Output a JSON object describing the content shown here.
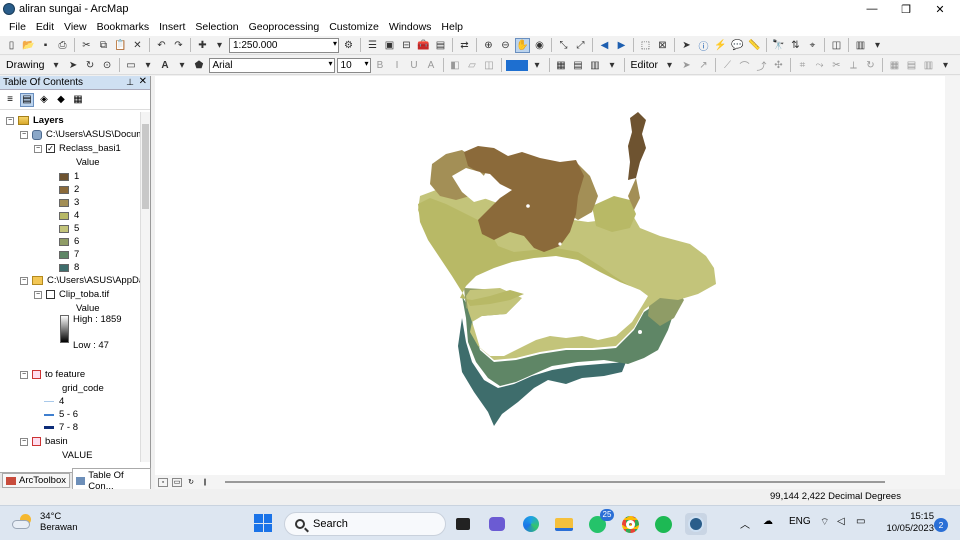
{
  "window": {
    "title": "aliran sungai - ArcMap",
    "minimize": "—",
    "maximize": "❐",
    "close": "✕"
  },
  "menu": [
    "File",
    "Edit",
    "View",
    "Bookmarks",
    "Insert",
    "Selection",
    "Geoprocessing",
    "Customize",
    "Windows",
    "Help"
  ],
  "toolbar": {
    "scale": "1:250.000",
    "drawing_label": "Drawing",
    "font_name": "Arial",
    "font_size": "10",
    "editor_label": "Editor"
  },
  "toc": {
    "title": "Table Of Contents",
    "pin": "⊥",
    "close": "✕",
    "layers_label": "Layers",
    "group1_path": "C:\\Users\\ASUS\\Docum",
    "reclass_name": "Reclass_basi1",
    "value_label": "Value",
    "classes": [
      {
        "label": "1",
        "color": "#6e5330"
      },
      {
        "label": "2",
        "color": "#8b6a3a"
      },
      {
        "label": "3",
        "color": "#a38f56"
      },
      {
        "label": "4",
        "color": "#b8b966"
      },
      {
        "label": "5",
        "color": "#c3c47a"
      },
      {
        "label": "6",
        "color": "#8f9c66"
      },
      {
        "label": "7",
        "color": "#5f8666"
      },
      {
        "label": "8",
        "color": "#3e6d6c"
      }
    ],
    "group2_path": "C:\\Users\\ASUS\\AppDa",
    "clip_name": "Clip_toba.tif",
    "clip_value_label": "Value",
    "high_label": "High : 1859",
    "low_label": "Low : 47",
    "feature_name": "to feature",
    "grid_code_label": "grid_code",
    "feature_classes": [
      {
        "label": "4",
        "color": "#a9c9ea"
      },
      {
        "label": "5 - 6",
        "color": "#3f7fcf"
      },
      {
        "label": "7 - 8",
        "color": "#0d2c78"
      }
    ],
    "basin_name": "basin",
    "basin_value_label": "VALUE",
    "tab_arctoolbox": "ArcToolbox",
    "tab_toc": "Table Of Con..."
  },
  "status": {
    "coordinates": "99,144  2,422 Decimal Degrees"
  },
  "taskbar": {
    "temperature": "34°C",
    "weather": "Berawan",
    "search_placeholder": "Search",
    "whatsapp_badge": "25",
    "language": "ENG",
    "time": "15:15",
    "date": "10/05/2023",
    "notifications": "2"
  },
  "colors": {
    "toc_header": "#cfe0f2",
    "taskbar": "#dde6f1",
    "accent": "#1e6fd0"
  }
}
